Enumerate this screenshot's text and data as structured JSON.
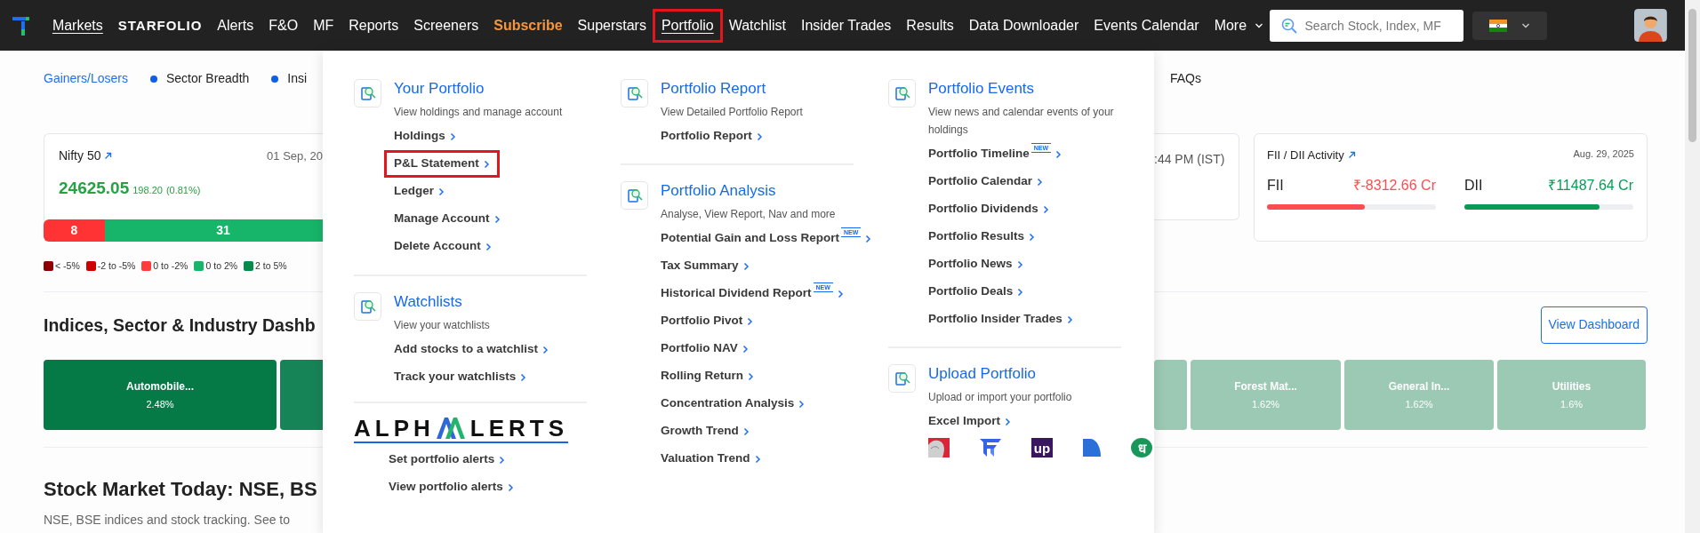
{
  "navbar": {
    "items": [
      {
        "label": "Markets",
        "kind": "link",
        "selected": true,
        "highlighted": false
      },
      {
        "label": "STARFOLIO",
        "kind": "brand",
        "selected": false,
        "highlighted": false
      },
      {
        "label": "Alerts",
        "kind": "link",
        "selected": false,
        "highlighted": false
      },
      {
        "label": "F&O",
        "kind": "link",
        "selected": false,
        "highlighted": false
      },
      {
        "label": "MF",
        "kind": "link",
        "selected": false,
        "highlighted": false
      },
      {
        "label": "Reports",
        "kind": "link",
        "selected": false,
        "highlighted": false
      },
      {
        "label": "Screeners",
        "kind": "link",
        "selected": false,
        "highlighted": false
      },
      {
        "label": "Subscribe",
        "kind": "promo",
        "selected": false,
        "highlighted": false
      },
      {
        "label": "Superstars",
        "kind": "link",
        "selected": false,
        "highlighted": false
      },
      {
        "label": "Portfolio",
        "kind": "link",
        "selected": true,
        "highlighted": true
      },
      {
        "label": "Watchlist",
        "kind": "link",
        "selected": false,
        "highlighted": false
      },
      {
        "label": "Insider Trades",
        "kind": "link",
        "selected": false,
        "highlighted": false
      },
      {
        "label": "Results",
        "kind": "link",
        "selected": false,
        "highlighted": false
      },
      {
        "label": "Data Downloader",
        "kind": "link",
        "selected": false,
        "highlighted": false
      },
      {
        "label": "Events Calendar",
        "kind": "link",
        "selected": false,
        "highlighted": false
      },
      {
        "label": "More",
        "kind": "dropdown",
        "selected": false,
        "highlighted": false
      }
    ],
    "search": {
      "placeholder": "Search Stock, Index, MF"
    }
  },
  "subnav": {
    "left": [
      {
        "label": "Gainers/Losers",
        "selected": true,
        "dot": false
      },
      {
        "label": "Sector Breadth",
        "selected": false,
        "dot": true
      },
      {
        "label": "Insi",
        "selected": false,
        "dot": true
      }
    ],
    "right": [
      {
        "label": "FAQs",
        "selected": false,
        "dot": false
      }
    ]
  },
  "index_card": {
    "name": "Nifty 50",
    "date": "01 Sep, 20",
    "time": ":44 PM (IST)",
    "value": "24625.05",
    "change": "198.20",
    "change_pct": "(0.81%)",
    "breadth": [
      {
        "label": "8",
        "color": "#ff3334"
      },
      {
        "label": "31",
        "color": "#16b56a"
      }
    ],
    "legend": [
      {
        "label": "< -5%",
        "color": "#8b0000"
      },
      {
        "label": "-2 to -5%",
        "color": "#cc0000"
      },
      {
        "label": "0 to -2%",
        "color": "#ff3b3b"
      },
      {
        "label": "0 to 2%",
        "color": "#16b56a"
      },
      {
        "label": "2 to 5%",
        "color": "#078a4c"
      }
    ]
  },
  "fii_card": {
    "title": "FII / DII Activity",
    "date": "Aug. 29, 2025",
    "items": [
      {
        "label": "FII",
        "amount": "₹-8312.66 Cr",
        "color": "#ff4d4f",
        "level": 0.58
      },
      {
        "label": "DII",
        "amount": "₹11487.64 Cr",
        "color": "#079b55",
        "level": 0.8
      }
    ]
  },
  "dashboard": {
    "heading": "Indices, Sector & Industry Dashb",
    "button": "View Dashboard",
    "tiles_left": [
      {
        "label": "Automobile...",
        "value": "2.48%",
        "color": "#057a47"
      },
      {
        "color": "#178457"
      }
    ],
    "tiles_right": [
      {
        "color": "#9bc9b4"
      },
      {
        "label": "Forest Mat...",
        "value": "1.62%",
        "color": "#9bc9b4"
      },
      {
        "label": "General In...",
        "value": "1.62%",
        "color": "#9bc9b4"
      },
      {
        "label": "Utilities",
        "value": "1.6%",
        "color": "#9bc9b4"
      }
    ]
  },
  "today": {
    "heading": "Stock Market Today: NSE, BS",
    "text": "NSE, BSE indices and stock tracking. See to"
  },
  "menu": {
    "columns": [
      {
        "sections": [
          {
            "kind": "section",
            "title": "Your Portfolio",
            "description": "View holdings and manage account",
            "items": [
              {
                "label": "Holdings",
                "highlighted": false
              },
              {
                "label": "P&L Statement",
                "highlighted": true
              },
              {
                "label": "Ledger",
                "highlighted": false
              },
              {
                "label": "Manage Account",
                "highlighted": false
              },
              {
                "label": "Delete Account",
                "highlighted": false
              }
            ]
          },
          {
            "kind": "section",
            "title": "Watchlists",
            "description": "View your watchlists",
            "items": [
              {
                "label": "Add stocks to a watchlist",
                "highlighted": false
              },
              {
                "label": "Track your watchlists",
                "highlighted": false
              }
            ]
          },
          {
            "kind": "alerts",
            "logo_start": "ALPH",
            "logo_end": "LERTS",
            "items": [
              {
                "label": "Set portfolio alerts",
                "highlighted": false
              },
              {
                "label": "View portfolio alerts",
                "highlighted": false
              }
            ]
          }
        ]
      },
      {
        "sections": [
          {
            "kind": "section",
            "title": "Portfolio Report",
            "description": "View Detailed Portfolio Report",
            "items": [
              {
                "label": "Portfolio Report",
                "highlighted": false
              }
            ]
          },
          {
            "kind": "section",
            "title": "Portfolio Analysis",
            "description": "Analyse, View Report, Nav and more",
            "items": [
              {
                "label": "Potential Gain and Loss Report",
                "badge": "NEW",
                "highlighted": false
              },
              {
                "label": "Tax Summary",
                "highlighted": false
              },
              {
                "label": "Historical Dividend Report",
                "badge": "NEW",
                "highlighted": false
              },
              {
                "label": "Portfolio Pivot",
                "highlighted": false
              },
              {
                "label": "Portfolio NAV",
                "highlighted": false
              },
              {
                "label": "Rolling Return",
                "highlighted": false
              },
              {
                "label": "Concentration Analysis",
                "highlighted": false
              },
              {
                "label": "Growth Trend",
                "highlighted": false
              },
              {
                "label": "Valuation Trend",
                "highlighted": false
              }
            ]
          }
        ]
      },
      {
        "sections": [
          {
            "kind": "section",
            "title": "Portfolio Events",
            "description": "View news and calendar events of your holdings",
            "items": [
              {
                "label": "Portfolio Timeline",
                "badge": "NEW",
                "highlighted": false
              },
              {
                "label": "Portfolio Calendar",
                "highlighted": false
              },
              {
                "label": "Portfolio Dividends",
                "highlighted": false
              },
              {
                "label": "Portfolio Results",
                "highlighted": false
              },
              {
                "label": "Portfolio News",
                "highlighted": false
              },
              {
                "label": "Portfolio Deals",
                "highlighted": false
              },
              {
                "label": "Portfolio Insider Trades",
                "highlighted": false
              }
            ]
          },
          {
            "kind": "section",
            "title": "Upload Portfolio",
            "description": "Upload or import your portfolio",
            "items": [
              {
                "label": "Excel Import",
                "highlighted": false
              }
            ],
            "logos": [
              {
                "kind": "bull"
              },
              {
                "kind": "arrow"
              },
              {
                "kind": "letters",
                "text": "up",
                "color": "#3b1660"
              },
              {
                "kind": "sail"
              },
              {
                "kind": "letters",
                "text": "ध",
                "color": "#17985a"
              }
            ]
          }
        ]
      }
    ]
  }
}
